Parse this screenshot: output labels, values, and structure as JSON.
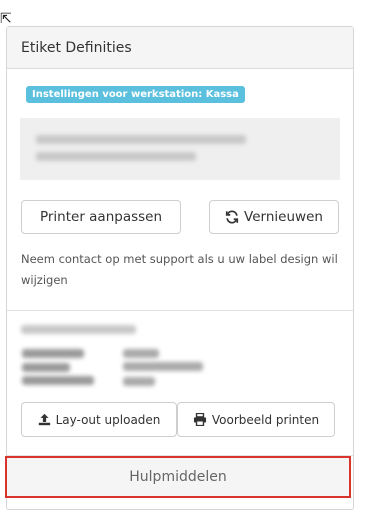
{
  "panel": {
    "title": "Etiket Definities",
    "workstation_badge": "Instellingen voor werkstation: Kassa",
    "buttons": {
      "change_printer": "Printer aanpassen",
      "refresh": "Vernieuwen",
      "upload_layout": "Lay-out uploaden",
      "print_example": "Voorbeeld printen"
    },
    "support_note": "Neem contact op met support als u uw label design wil wijzigen",
    "tools_button": "Hulpmiddelen"
  },
  "icons": {
    "refresh": "refresh-icon",
    "upload": "upload-icon",
    "print": "print-icon",
    "cursor": "mouse-cursor-icon"
  },
  "colors": {
    "badge": "#5bc0de",
    "highlight_border": "#d9342b",
    "header_bg": "#f5f5f5"
  }
}
